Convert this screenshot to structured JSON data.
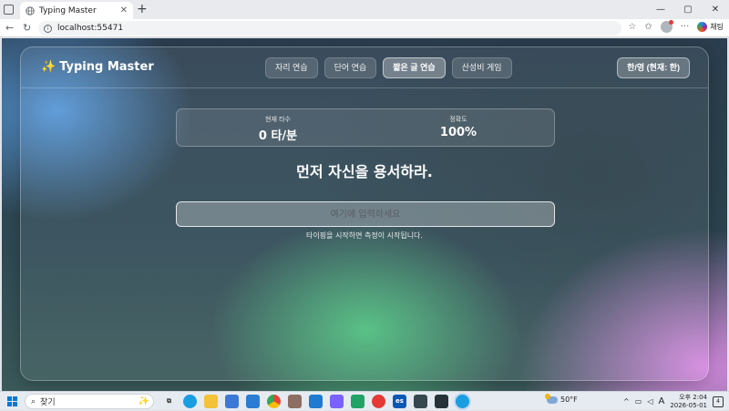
{
  "browser": {
    "tab_title": "Typing Master",
    "new_tab_symbol": "+",
    "close_symbol": "✕",
    "url": "localhost:55471",
    "copilot_label": "채팅",
    "window_controls": {
      "minimize": "—",
      "maximize": "▢",
      "close": "✕"
    }
  },
  "app": {
    "brand": "Typing Master",
    "nav": [
      {
        "label": "자리 연습"
      },
      {
        "label": "단어 연습"
      },
      {
        "label": "짧은 글 연습"
      },
      {
        "label": "산성비 게임"
      }
    ],
    "active_nav": "짧은 글 연습",
    "lang_toggle": "한/영 (현재: 한)",
    "stats": {
      "speed_label": "현재 타수",
      "speed_value": "0 타/분",
      "accuracy_label": "정확도",
      "accuracy_value": "100%"
    },
    "sentence": "먼저 자신을 용서하라.",
    "input": {
      "placeholder": "여기에 입력하세요",
      "value": ""
    },
    "hint": "타이핑을 시작하면 측정이 시작됩니다."
  },
  "taskbar": {
    "search_placeholder": "찾기",
    "weather_temp": "50°F",
    "ime_label": "A",
    "clock_time": "오후 2:04",
    "clock_date": "2026-05-01",
    "notification_count": "4",
    "apps": [
      "task-view",
      "edge",
      "file-explorer",
      "store",
      "mail",
      "chrome",
      "app",
      "vscode",
      "app",
      "app",
      "app",
      "es",
      "app",
      "app",
      "edge-active"
    ]
  },
  "colors": {
    "accent_brand": "#ffd54f",
    "bg_blue": "#5aa0e6",
    "bg_green": "#50c882",
    "bg_pink": "#dc8ce6"
  }
}
